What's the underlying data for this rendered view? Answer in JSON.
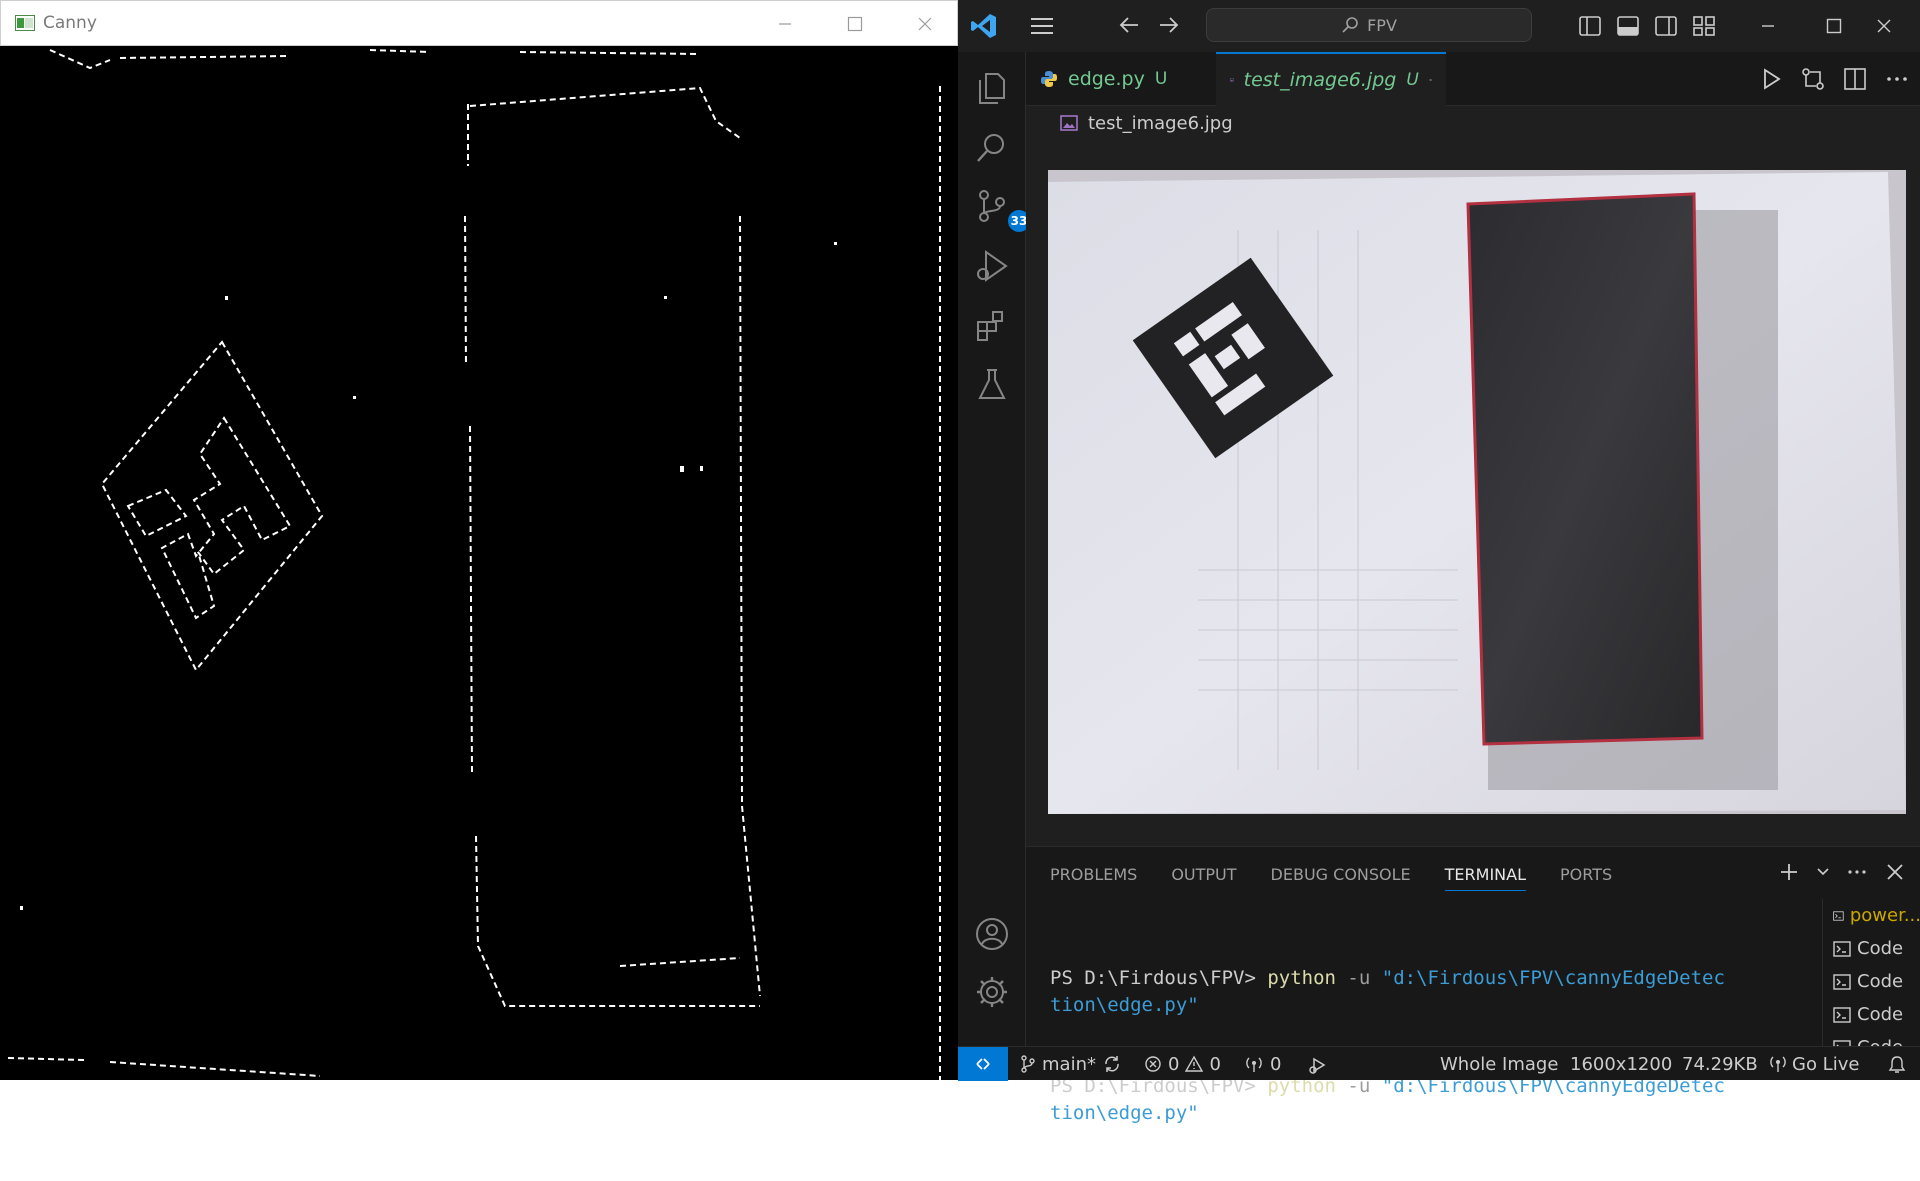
{
  "canny_window": {
    "title": "Canny"
  },
  "vscode": {
    "command_center": "FPV",
    "activity_bar": {
      "source_control_badge": "33"
    },
    "tabs": [
      {
        "label": "edge.py",
        "status": "U"
      },
      {
        "label": "test_image6.jpg",
        "status": "U"
      }
    ],
    "breadcrumb": "test_image6.jpg",
    "panel": {
      "tabs": [
        "PROBLEMS",
        "OUTPUT",
        "DEBUG CONSOLE",
        "TERMINAL",
        "PORTS"
      ],
      "active_tab": "TERMINAL",
      "terminal_lines": [
        {
          "prompt": "PS D:\\Firdous\\FPV> ",
          "cmd": "python",
          "flag": " -u ",
          "arg": "\"d:\\Firdous\\FPV\\cannyEdgeDetection\\edge.py\""
        },
        {
          "prompt": "PS D:\\Firdous\\FPV> ",
          "cmd": "python",
          "flag": " -u ",
          "arg": "\"d:\\Firdous\\FPV\\cannyEdgeDetection\\edge.py\""
        }
      ],
      "terminal_list": [
        "power...",
        "Code",
        "Code",
        "Code",
        "Code"
      ]
    },
    "status_bar": {
      "branch": "main*",
      "errors": "0",
      "warnings": "0",
      "ports": "0",
      "image_mode": "Whole Image",
      "dimensions": "1600x1200",
      "size": "74.29KB",
      "go_live": "Go Live"
    },
    "colors": {
      "accent": "#0078d4",
      "untracked": "#73c991",
      "terminal_cmd": "#dcdcaa",
      "terminal_string": "#3b9cd6"
    }
  }
}
